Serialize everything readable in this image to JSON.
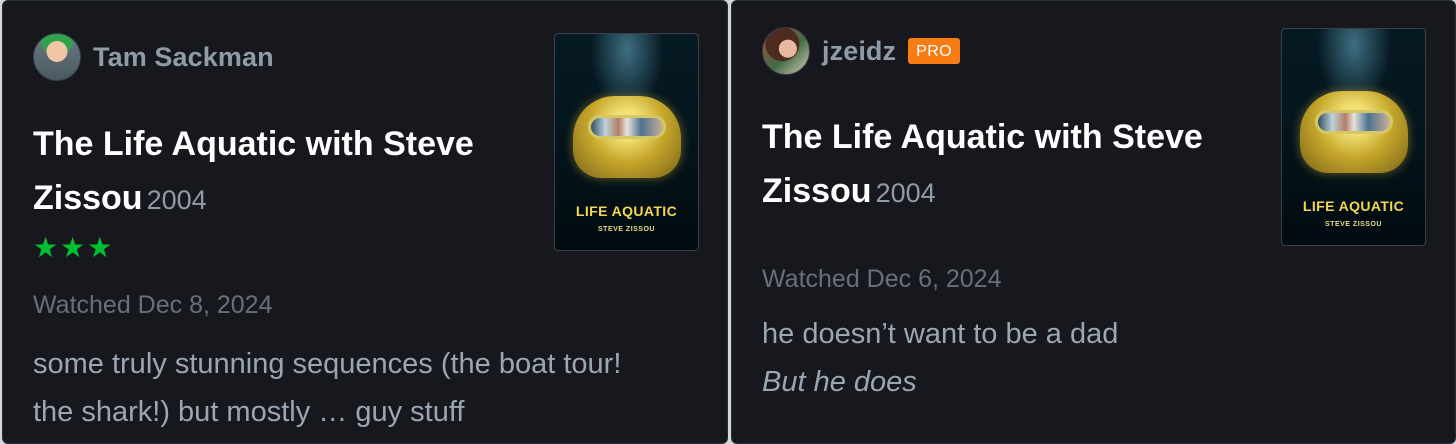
{
  "reviews": [
    {
      "username": "Tam Sackman",
      "film_title": "The Life Aquatic with Steve Zissou",
      "year": "2004",
      "rating_stars": "★★★",
      "rating_value": 3,
      "watched": "Watched Dec 8, 2024",
      "review_text": "some truly stunning sequences (the boat tour! the shark!) but mostly … guy stuff",
      "poster_title": "LIFE AQUATIC",
      "poster_subtitle": "STEVE ZISSOU"
    },
    {
      "username": "jzeidz",
      "badge": "PRO",
      "film_title": "The Life Aquatic with Steve Zissou",
      "year": "2004",
      "watched": "Watched Dec 6, 2024",
      "review_lines": [
        "he doesn’t want to be a dad",
        "But he does"
      ],
      "poster_title": "LIFE AQUATIC",
      "poster_subtitle": "STEVE ZISSOU"
    }
  ],
  "colors": {
    "card_background": "#16181d",
    "page_background": "#d4d6da",
    "rating_green": "#00c030",
    "pro_badge": "#f67c13"
  }
}
